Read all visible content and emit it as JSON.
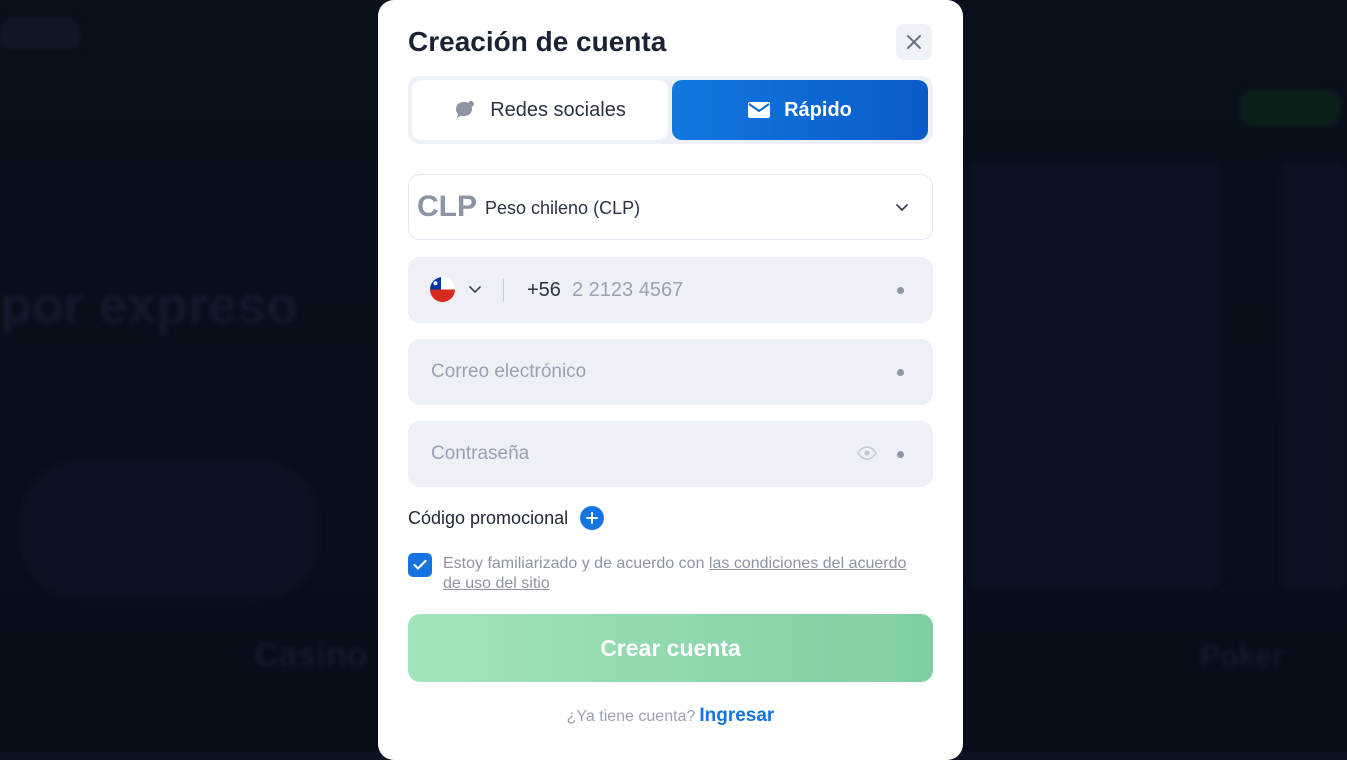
{
  "background": {
    "heading_fragment": "por expreso",
    "tile_casino": "Casino",
    "tile_poker": "Poker"
  },
  "modal": {
    "title": "Creación de cuenta",
    "close_icon": "close-icon",
    "tabs": [
      {
        "label": "Redes sociales",
        "icon": "chat-bubble-icon",
        "active": false
      },
      {
        "label": "Rápido",
        "icon": "envelope-icon",
        "active": true
      }
    ],
    "currency": {
      "code": "CLP",
      "name": "Peso chileno (CLP)"
    },
    "phone": {
      "country_flag": "chile-flag-icon",
      "code": "+56",
      "placeholder": "2 2123 4567"
    },
    "email": {
      "placeholder": "Correo electrónico"
    },
    "password": {
      "placeholder": "Contraseña"
    },
    "promo": {
      "label": "Código promocional"
    },
    "agreement": {
      "checked": true,
      "text": "Estoy familiarizado y de acuerdo con ",
      "link": "las condiciones del acuerdo de uso del sitio"
    },
    "submit_label": "Crear cuenta",
    "login": {
      "prompt": "¿Ya tiene cuenta?",
      "link": "Ingresar"
    },
    "colors": {
      "accent": "#1574e0",
      "submit_green": "#8fd8ae",
      "input_bg": "#edf0f7"
    }
  }
}
